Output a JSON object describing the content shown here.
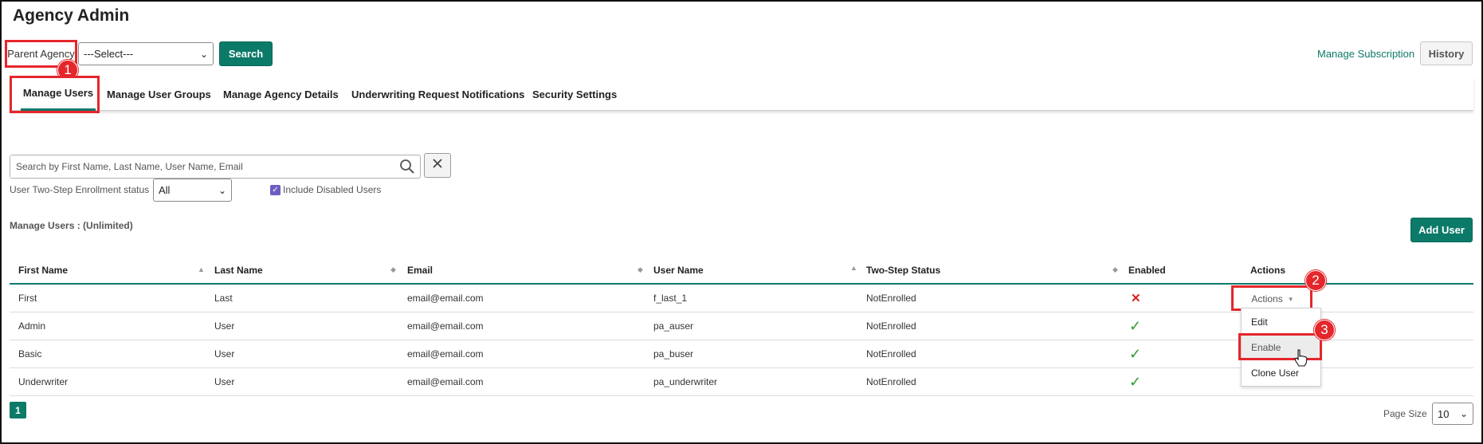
{
  "page": {
    "title": "Agency Admin"
  },
  "toolbar": {
    "parent_agency_label": "Parent Agency",
    "parent_agency_select": "---Select---",
    "search_label": "Search",
    "manage_subscription_label": "Manage Subscription",
    "history_label": "History"
  },
  "annotations": {
    "badge1": "1",
    "badge2": "2",
    "badge3": "3"
  },
  "tabs": [
    {
      "label": "Manage Users",
      "active": true
    },
    {
      "label": "Manage User Groups"
    },
    {
      "label": "Manage Agency Details"
    },
    {
      "label": "Underwriting Request Notifications"
    },
    {
      "label": "Security Settings"
    }
  ],
  "filters": {
    "search_placeholder": "Search by First Name, Last Name, User Name, Email",
    "enrollment_label": "User Two-Step Enrollment status",
    "enrollment_value": "All",
    "include_disabled_label": "Include Disabled Users",
    "include_disabled_checked": true
  },
  "section": {
    "title": "Manage Users : (Unlimited)",
    "add_user_label": "Add User"
  },
  "table": {
    "columns": [
      "First Name",
      "Last Name",
      "Email",
      "User Name",
      "Two-Step Status",
      "Enabled",
      "Actions"
    ],
    "rows": [
      {
        "first": "First",
        "last": "Last",
        "email": "email@email.com",
        "username": "f_last_1",
        "status": "NotEnrolled",
        "enabled": false
      },
      {
        "first": "Admin",
        "last": "User",
        "email": "email@email.com",
        "username": "pa_auser",
        "status": "NotEnrolled",
        "enabled": true
      },
      {
        "first": "Basic",
        "last": "User",
        "email": "email@email.com",
        "username": "pa_buser",
        "status": "NotEnrolled",
        "enabled": true
      },
      {
        "first": "Underwriter",
        "last": "User",
        "email": "email@email.com",
        "username": "pa_underwriter",
        "status": "NotEnrolled",
        "enabled": true
      }
    ]
  },
  "actions_menu": {
    "button_label": "Actions",
    "items": [
      "Edit",
      "Enable",
      "Clone User"
    ],
    "highlighted": "Enable"
  },
  "pagination": {
    "current_page": "1",
    "page_size_label": "Page Size",
    "page_size_value": "10"
  },
  "colors": {
    "accent": "#0c7a68",
    "annotation": "#e5262b",
    "checkbox": "#6d5fc2"
  }
}
